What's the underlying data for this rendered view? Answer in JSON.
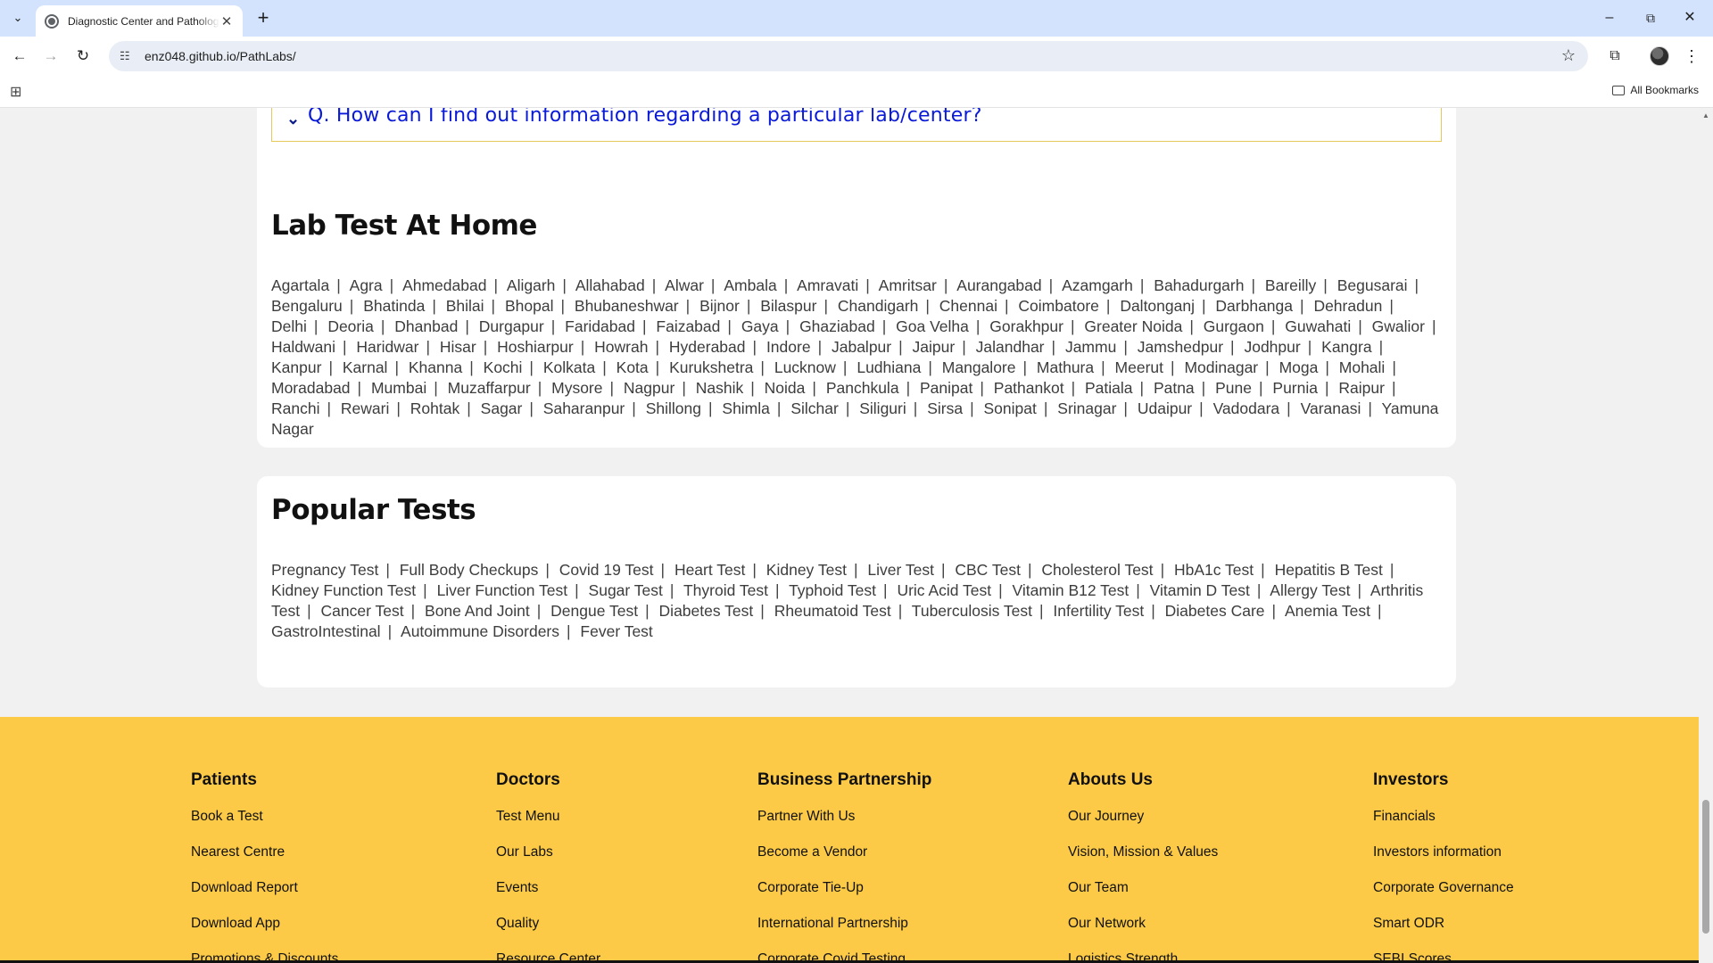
{
  "browser": {
    "tab_title": "Diagnostic Center and Pathology Lab",
    "url": "enz048.github.io/PathLabs/",
    "all_bookmarks": "All Bookmarks"
  },
  "faq": {
    "question": "Q. How can I find out information regarding a particular lab/center?"
  },
  "lab_test_at_home": {
    "title": "Lab Test At Home",
    "cities": [
      "Agartala",
      "Agra",
      "Ahmedabad",
      "Aligarh",
      "Allahabad",
      "Alwar",
      "Ambala",
      "Amravati",
      "Amritsar",
      "Aurangabad",
      "Azamgarh",
      "Bahadurgarh",
      "Bareilly",
      "Begusarai",
      "Bengaluru",
      "Bhatinda",
      "Bhilai",
      "Bhopal",
      "Bhubaneshwar",
      "Bijnor",
      "Bilaspur",
      "Chandigarh",
      "Chennai",
      "Coimbatore",
      "Daltonganj",
      "Darbhanga",
      "Dehradun",
      "Delhi",
      "Deoria",
      "Dhanbad",
      "Durgapur",
      "Faridabad",
      "Faizabad",
      "Gaya",
      "Ghaziabad",
      "Goa Velha",
      "Gorakhpur",
      "Greater Noida",
      "Gurgaon",
      "Guwahati",
      "Gwalior",
      "Haldwani",
      "Haridwar",
      "Hisar",
      "Hoshiarpur",
      "Howrah",
      "Hyderabad",
      "Indore",
      "Jabalpur",
      "Jaipur",
      "Jalandhar",
      "Jammu",
      "Jamshedpur",
      "Jodhpur",
      "Kangra",
      "Kanpur",
      "Karnal",
      "Khanna",
      "Kochi",
      "Kolkata",
      "Kota",
      "Kurukshetra",
      "Lucknow",
      "Ludhiana",
      "Mangalore",
      "Mathura",
      "Meerut",
      "Modinagar",
      "Moga",
      "Mohali",
      "Moradabad",
      "Mumbai",
      "Muzaffarpur",
      "Mysore",
      "Nagpur",
      "Nashik",
      "Noida",
      "Panchkula",
      "Panipat",
      "Pathankot",
      "Patiala",
      "Patna",
      "Pune",
      "Purnia",
      "Raipur",
      "Ranchi",
      "Rewari",
      "Rohtak",
      "Sagar",
      "Saharanpur",
      "Shillong",
      "Shimla",
      "Silchar",
      "Siliguri",
      "Sirsa",
      "Sonipat",
      "Srinagar",
      "Udaipur",
      "Vadodara",
      "Varanasi",
      "Yamuna Nagar"
    ]
  },
  "popular_tests": {
    "title": "Popular Tests",
    "tests": [
      "Pregnancy Test",
      "Full Body Checkups",
      "Covid 19 Test",
      "Heart Test",
      "Kidney Test",
      "Liver Test",
      "CBC Test",
      "Cholesterol Test",
      "HbA1c Test",
      "Hepatitis B Test",
      "Kidney Function Test",
      "Liver Function Test",
      "Sugar Test",
      "Thyroid Test",
      "Typhoid Test",
      "Uric Acid Test",
      "Vitamin B12 Test",
      "Vitamin D Test",
      "Allergy Test",
      "Arthritis Test",
      "Cancer Test",
      "Bone And Joint",
      "Dengue Test",
      "Diabetes Test",
      "Rheumatoid Test",
      "Tuberculosis Test",
      "Infertility Test",
      "Diabetes Care",
      "Anemia Test",
      "GastroIntestinal",
      "Autoimmune Disorders",
      "Fever Test"
    ]
  },
  "footer": {
    "patients": {
      "heading": "Patients",
      "links": [
        "Book a Test",
        "Nearest Centre",
        "Download Report",
        "Download App",
        "Promotions & Discounts"
      ]
    },
    "doctors": {
      "heading": "Doctors",
      "links": [
        "Test Menu",
        "Our Labs",
        "Events",
        "Quality",
        "Resource Center"
      ]
    },
    "business": {
      "heading": "Business Partnership",
      "links": [
        "Partner With Us",
        "Become a Vendor",
        "Corporate Tie-Up",
        "International Partnership",
        "Corporate Covid Testing"
      ]
    },
    "about": {
      "heading": "Abouts Us",
      "links": [
        "Our Journey",
        "Vision, Mission & Values",
        "Our Team",
        "Our Network",
        "Logistics Strength"
      ]
    },
    "investors": {
      "heading": "Investors",
      "links": [
        "Financials",
        "Investors information",
        "Corporate Governance",
        "Smart ODR",
        "SEBI Scores"
      ]
    }
  },
  "colors": {
    "footer_bg": "#fcca47",
    "faq_link": "#0a1ad6",
    "page_bg": "#f1f1f1"
  },
  "icons": {
    "tab_search": "chevron-down-icon",
    "favicon": "globe-icon",
    "back": "arrow-left-icon",
    "forward": "arrow-right-icon",
    "reload": "reload-icon",
    "site_info": "tune-icon",
    "bookmark": "star-icon",
    "extensions": "puzzle-icon",
    "menu": "kebab-menu-icon"
  }
}
